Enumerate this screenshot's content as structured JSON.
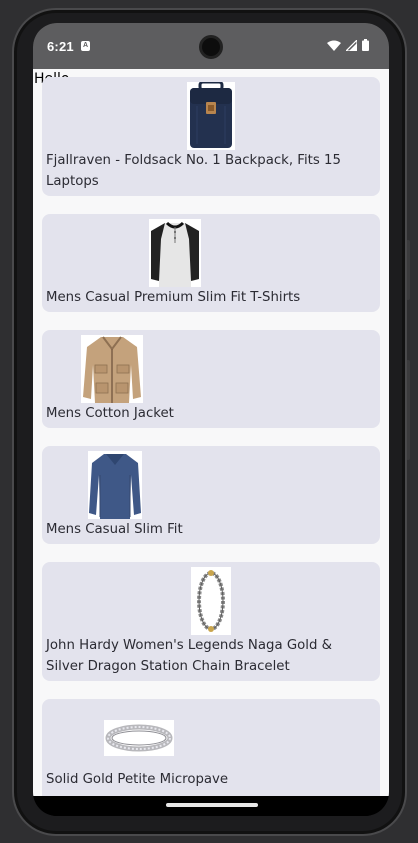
{
  "status_bar": {
    "time": "6:21",
    "notification_label": "A",
    "icons": [
      "wifi-icon",
      "signal-icon",
      "battery-icon"
    ]
  },
  "app": {
    "greeting": "Hello"
  },
  "products": [
    {
      "title": "Fjallraven - Foldsack No. 1 Backpack, Fits 15 Laptops",
      "image": "backpack-image"
    },
    {
      "title": "Mens Casual Premium Slim Fit T-Shirts",
      "image": "tshirt-image"
    },
    {
      "title": "Mens Cotton Jacket",
      "image": "jacket-image"
    },
    {
      "title": "Mens Casual Slim Fit",
      "image": "longsleeve-image"
    },
    {
      "title": "John Hardy Women's Legends Naga Gold & Silver Dragon Station Chain Bracelet",
      "image": "bracelet-image"
    },
    {
      "title": "Solid Gold Petite Micropave",
      "image": "ring-image"
    }
  ],
  "colors": {
    "card_background": "#e3e3ed",
    "screen_background": "#f8f8f9",
    "status_bar": "#5d5d5f"
  }
}
